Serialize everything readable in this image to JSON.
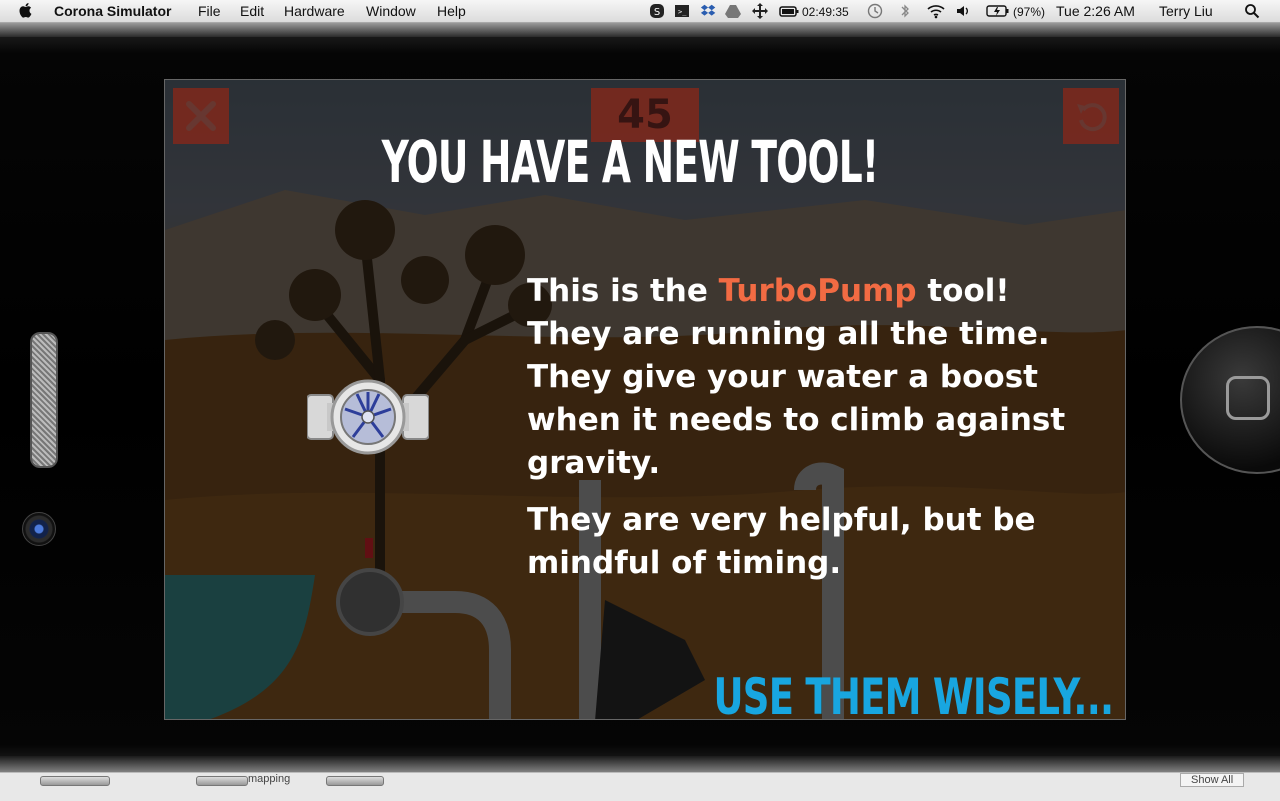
{
  "menubar": {
    "app_name": "Corona Simulator",
    "menus": [
      "File",
      "Edit",
      "Hardware",
      "Window",
      "Help"
    ],
    "timer": "02:49:35",
    "battery": "(97%)",
    "clock": "Tue 2:26 AM",
    "user": "Terry Liu"
  },
  "game": {
    "score": "45",
    "title": "YOU HAVE A NEW TOOL!",
    "intro_before": "This is the ",
    "tool_name": "TurboPump",
    "intro_after": " tool!",
    "para1_rest": "They are running all the time. They give your water a boost when it needs to climb against gravity.",
    "para2": "They are very helpful, but be mindful of timing.",
    "footer": "USE THEM WISELY...",
    "accent_color": "#f26b43",
    "footer_color": "#18a6e0",
    "buttons": {
      "close": "close-icon",
      "restart": "restart-icon"
    }
  },
  "bottom_strip": {
    "label_left": "mapping",
    "label_right": "Show All"
  }
}
